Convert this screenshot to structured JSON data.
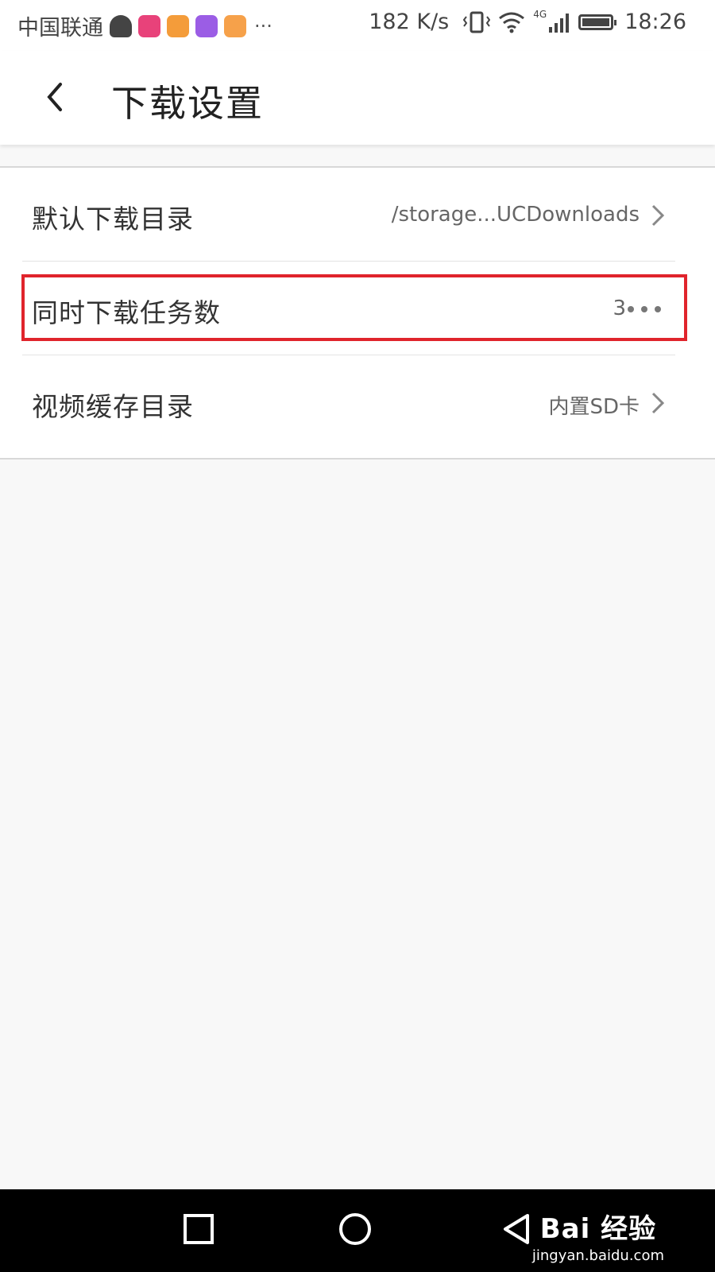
{
  "status_bar": {
    "carrier": "中国联通",
    "more": "···",
    "speed": "182 K/s",
    "network": "4G",
    "time": "18:26",
    "app_colors": [
      "#444444",
      "#e8427a",
      "#f49c3a",
      "#9b5de5",
      "#f6a14a"
    ]
  },
  "header": {
    "title": "下载设置"
  },
  "settings": {
    "items": [
      {
        "label": "默认下载目录",
        "value": "/storage...UCDownloads"
      },
      {
        "label": "同时下载任务数",
        "value": "3"
      },
      {
        "label": "视频缓存目录",
        "value": "内置SD卡"
      }
    ]
  },
  "watermark": {
    "brand": "Bai 经验",
    "url": "jingyan.baidu.com"
  },
  "colors": {
    "highlight": "#e0242c"
  }
}
